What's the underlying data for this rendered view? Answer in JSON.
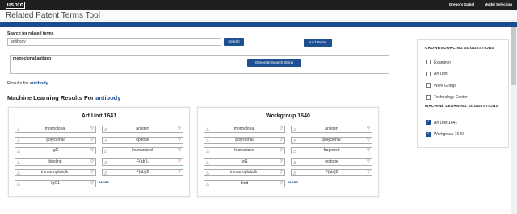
{
  "header": {
    "logo": "uspto",
    "user": "Gregory Gabel",
    "model_selection": "Model Selection"
  },
  "app_title": "Related Patent Terms Tool",
  "search": {
    "label": "Search for related terms",
    "value": "antibody",
    "search_btn": "Search",
    "add_terms_btn": "Add Terms",
    "terms_value": "monoclonal,antigen",
    "generate_btn": "Generate Search String"
  },
  "results_for": {
    "prefix": "Results for ",
    "term": "antibody"
  },
  "ml_results": {
    "prefix": "Machine Learning Results For ",
    "term": "antibody"
  },
  "cards": [
    {
      "title": "Art Unit 1641",
      "left": [
        {
          "t": "monoclonal",
          "tri": "green"
        },
        {
          "t": "polyclonal"
        },
        {
          "t": "IgG"
        },
        {
          "t": "binding"
        },
        {
          "t": "immunoglobulin"
        },
        {
          "t": "IgG1"
        }
      ],
      "right": [
        {
          "t": "antigen"
        },
        {
          "t": "epitope"
        },
        {
          "t": "humanized"
        },
        {
          "t": "F(ab')₂",
          "dd": "red"
        },
        {
          "t": "F(ab')2"
        }
      ]
    },
    {
      "title": "Workgroup 1640",
      "left": [
        {
          "t": "monoclonal"
        },
        {
          "t": "polyclonal"
        },
        {
          "t": "humanized"
        },
        {
          "t": "IgG"
        },
        {
          "t": "immunoglobulin"
        },
        {
          "t": "bind"
        }
      ],
      "right": [
        {
          "t": "antigen",
          "tri": "green"
        },
        {
          "t": "polyclonal"
        },
        {
          "t": "fragment"
        },
        {
          "t": "epitope"
        },
        {
          "t": "F(ab')2"
        }
      ]
    }
  ],
  "more_label": "MORE...",
  "panel": {
    "crowd_title": "CROWDSOURCING SUGGESTIONS",
    "crowd": [
      {
        "label": "Examiner",
        "checked": false
      },
      {
        "label": "Art Unit",
        "checked": false
      },
      {
        "label": "Work Group",
        "checked": false
      },
      {
        "label": "Technology Center",
        "checked": false
      }
    ],
    "ml_title": "MACHINE LEARNING SUGGESTIONS",
    "ml": [
      {
        "label": "Art Unit 1641",
        "checked": true
      },
      {
        "label": "Workgroup 1640",
        "checked": true
      }
    ]
  }
}
